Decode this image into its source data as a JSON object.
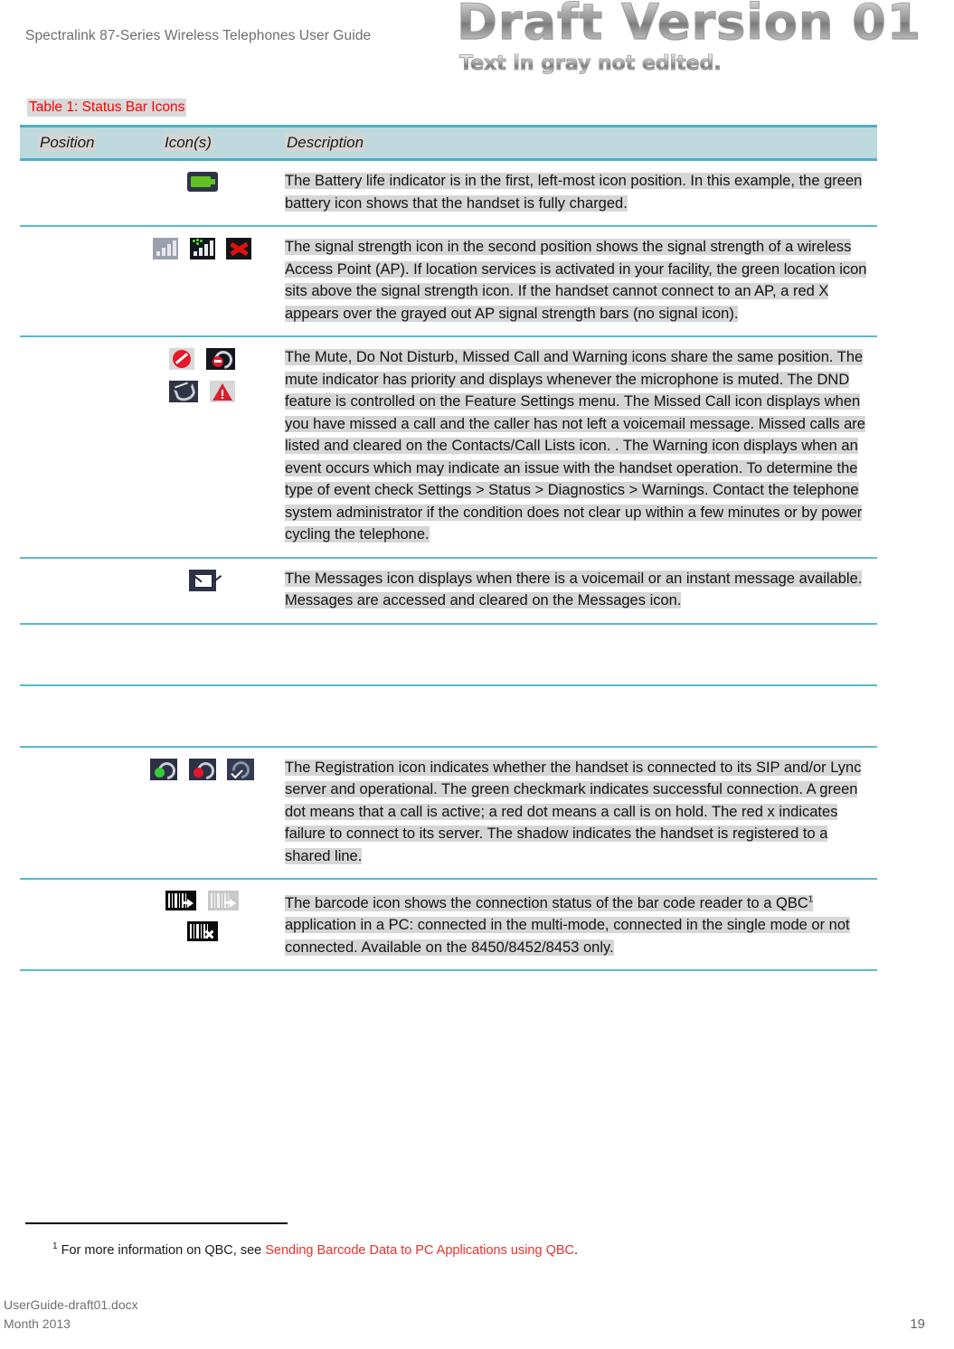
{
  "header": {
    "doc_title": "Spectralink 87-Series Wireless Telephones User Guide",
    "watermark_main": "Draft Version 01",
    "watermark_sub": "Text in gray not edited."
  },
  "table": {
    "caption": "Table 1: Status Bar Icons",
    "columns": [
      "Position",
      "Icon(s)",
      "Description"
    ],
    "accent_border": "#56bccd",
    "header_bg": "#bdd9de",
    "caption_color": "#ff0000",
    "highlight_bg": "#d6d6d6",
    "rows": [
      {
        "position": "",
        "icons": [
          "battery-full-icon"
        ],
        "description": "The Battery life indicator is in the first, left-most icon position. In this example, the green battery icon shows that the handset is fully charged."
      },
      {
        "position": "",
        "icons": [
          "signal-strength-gray-icon",
          "signal-strength-location-icon",
          "no-signal-red-x-icon"
        ],
        "description": "The signal strength icon in the second position shows the signal strength of a wireless Access Point (AP). If location services is activated in your facility, the green location icon sits above the signal strength icon. If the handset cannot connect to an AP, a red X appears over the grayed out AP signal strength bars (no signal icon)."
      },
      {
        "position": "",
        "icons": [
          "mute-icon",
          "do-not-disturb-icon",
          "missed-call-icon",
          "warning-icon"
        ],
        "description": "The Mute, Do Not Disturb, Missed Call and Warning icons share the same position. The mute indicator has priority and displays whenever the microphone is muted. The DND feature is controlled on the Feature Settings menu. The Missed Call icon displays when you have missed a call and the caller has not left a voicemail message. Missed calls are listed and cleared on the Contacts/Call Lists icon. . The Warning icon displays when an event occurs which may indicate an issue with the handset operation. To determine the type of event check Settings > Status > Diagnostics > Warnings. Contact the telephone system administrator if the condition does not clear up within a few minutes or by power cycling the telephone."
      },
      {
        "position": "",
        "icons": [
          "messages-envelope-icon"
        ],
        "description": "The Messages icon displays when there is a voicemail or an instant message available. Messages are accessed and cleared on the Messages icon."
      },
      {
        "position": "",
        "icons": [],
        "description": ""
      },
      {
        "position": "",
        "icons": [],
        "description": ""
      },
      {
        "position": "",
        "icons": [
          "registration-active-call-icon",
          "registration-held-call-icon",
          "registration-shared-line-icon"
        ],
        "description": "The Registration icon indicates whether the handset is connected to its SIP and/or Lync server and operational. The green checkmark indicates successful connection. A green dot means that a call is active; a red dot means a call is on hold. The red x indicates failure to connect to its server. The shadow indicates the handset is registered to a shared line."
      },
      {
        "position": "",
        "icons": [
          "barcode-multi-mode-icon",
          "barcode-single-mode-icon",
          "barcode-not-connected-icon"
        ],
        "description_pre": "The barcode icon shows the connection status of the bar code reader to a QBC",
        "description_sup": "1",
        "description_post": " application in a PC: connected in the multi-mode, connected in the single mode or not connected. Available on the 8450/8452/8453 only."
      }
    ]
  },
  "footnote": {
    "marker": "1",
    "text_before": " For more information on QBC, see ",
    "link_text": "Sending Barcode Data to PC Applications using QBC",
    "text_after": ".",
    "link_color": "#e8312a"
  },
  "footer": {
    "file_name": "UserGuide-draft01.docx",
    "date": "Month 2013",
    "page_number": "19"
  }
}
